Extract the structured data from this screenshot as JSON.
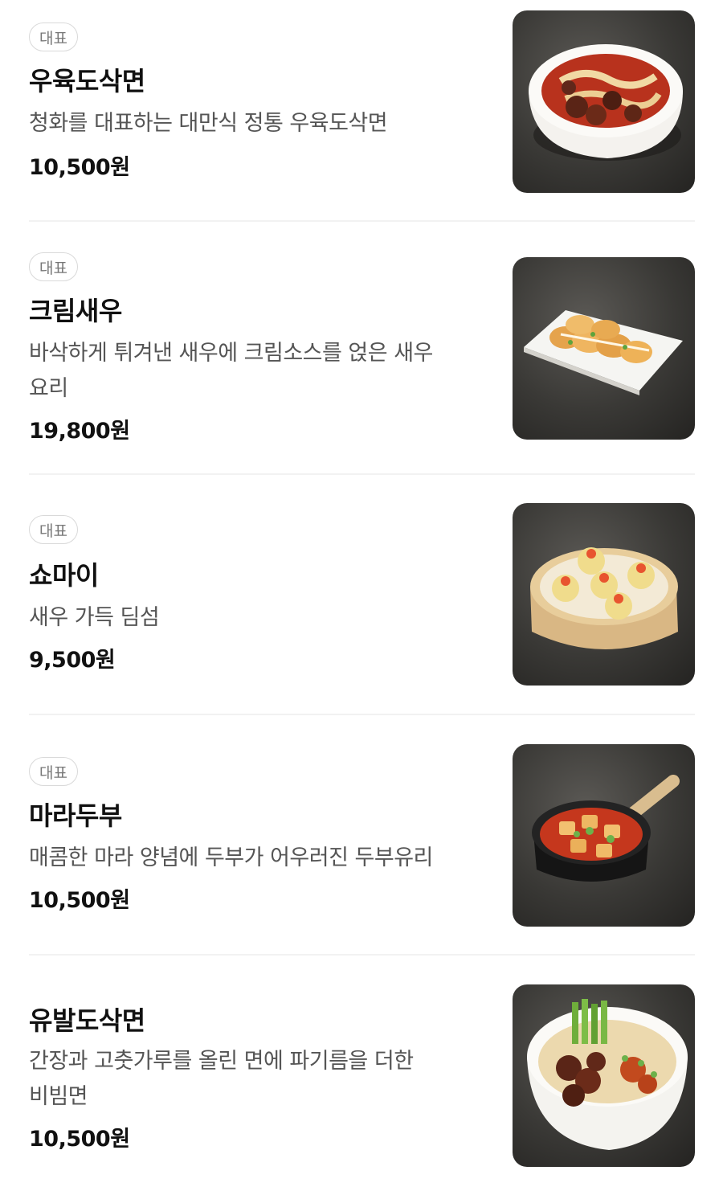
{
  "menu": {
    "items": [
      {
        "badge": "대표",
        "name": "우육도삭면",
        "desc_lines": [
          "청화를 대표하는 대만식 정통 우육도삭면"
        ],
        "price": "10,500원",
        "image_icon": "beef-noodle-soup-photo"
      },
      {
        "badge": "대표",
        "name": "크림새우",
        "desc_lines": [
          "바삭하게 튀겨낸 새우에 크림소스를 얹은 새우",
          "요리"
        ],
        "price": "19,800원",
        "image_icon": "cream-shrimp-photo"
      },
      {
        "badge": "대표",
        "name": "쇼마이",
        "desc_lines": [
          "새우 가득 딤섬"
        ],
        "price": "9,500원",
        "image_icon": "shumai-dimsum-photo"
      },
      {
        "badge": "대표",
        "name": "마라두부",
        "desc_lines": [
          "매콤한 마라 양념에 두부가 어우러진 두부유리"
        ],
        "price": "10,500원",
        "image_icon": "mala-tofu-photo"
      },
      {
        "badge": "",
        "name": "유발도삭면",
        "desc_lines": [
          "간장과 고춧가루를 올린 면에 파기름을 더한",
          "비빔면"
        ],
        "price": "10,500원",
        "image_icon": "oil-splash-noodle-photo"
      }
    ]
  }
}
